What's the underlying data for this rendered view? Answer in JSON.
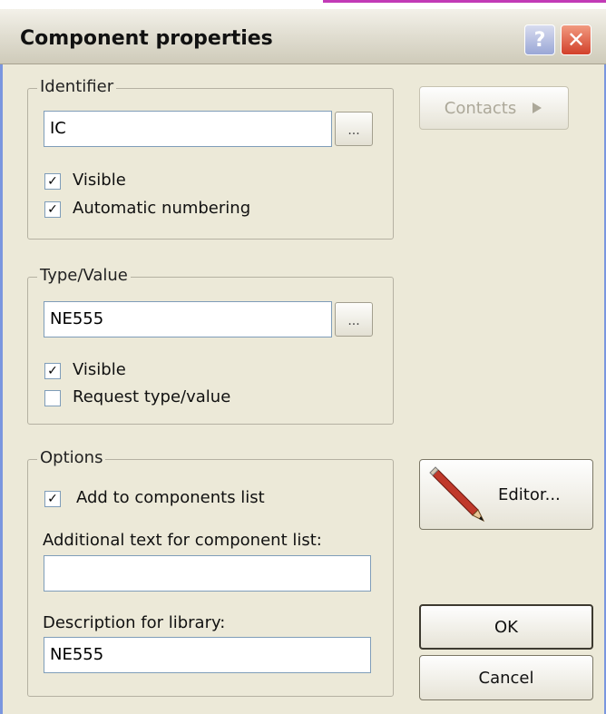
{
  "window": {
    "title": "Component properties"
  },
  "titlebar_buttons": {
    "help": "?",
    "close": "✕"
  },
  "identifier": {
    "group_label": "Identifier",
    "value": "IC",
    "browse_label": "...",
    "visible": {
      "label": "Visible",
      "checked": true
    },
    "auto_numbering": {
      "label": "Automatic numbering",
      "checked": true
    }
  },
  "type_value": {
    "group_label": "Type/Value",
    "value": "NE555",
    "browse_label": "...",
    "visible": {
      "label": "Visible",
      "checked": true
    },
    "request": {
      "label": "Request type/value",
      "checked": false
    }
  },
  "options": {
    "group_label": "Options",
    "add_to_list": {
      "label": "Add to components list",
      "checked": true
    },
    "additional_text_label": "Additional text for component list:",
    "additional_text_value": "",
    "description_label": "Description for library:",
    "description_value": "NE555"
  },
  "buttons": {
    "contacts": "Contacts",
    "editor": "Editor...",
    "ok": "OK",
    "cancel": "Cancel"
  },
  "icons": {
    "contacts_arrow": "triangle-right-icon",
    "editor": "pencil-icon"
  }
}
